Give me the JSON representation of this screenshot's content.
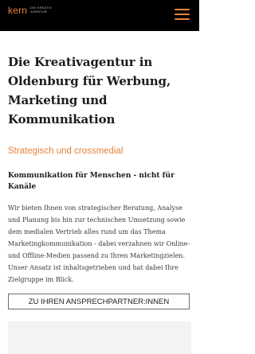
{
  "header": {
    "logo_word": "kern",
    "logo_tagline_1": "DIE KREATIV",
    "logo_tagline_2": "AGENTUR",
    "menu_icon": "hamburger-menu-icon"
  },
  "main": {
    "headline": "Die Kreativagentur in Oldenburg für Werbung, Marketing und Kommunikation",
    "subheadline": "Strategisch und crossmedial",
    "lead": "Kommunikation für Menschen - nicht für Kanäle",
    "body": "Wir bieten Ihnen von strategischer Beratung, Analyse und Planung bis hin zur technischen Umsetzung sowie dem medialen Vertrieb alles rund um das Thema Marketingkommunikation - dabei verzahnen wir Online- und Offline-Medien passend zu Ihren Marketingzielen. Unser Ansatz ist inhaltsgetrieben und hat dabei Ihre Zielgruppe im Blick.",
    "cta_label": "ZU IHREN ANSPRECHPARTNER:INNEN"
  },
  "colors": {
    "accent": "#e8823a",
    "header_bg": "#000000",
    "text": "#1c1c1c"
  }
}
